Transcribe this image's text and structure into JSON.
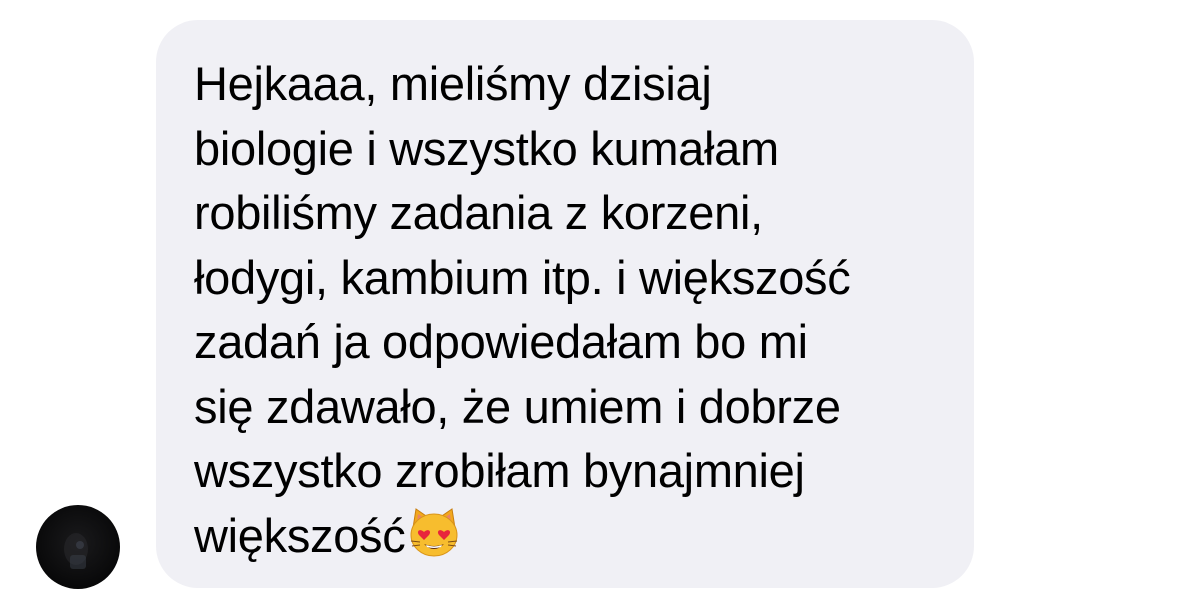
{
  "conversation": {
    "message": {
      "lines": [
        "Hejkaaa, mieliśmy dzisiaj",
        "biologie i wszystko kumałam",
        "robiliśmy zadania z korzeni,",
        "łodygi, kambium itp. i większość",
        "zadań ja odpowiedałam bo mi",
        "się zdawało, że umiem i dobrze",
        "wszystko zrobiłam bynajmniej",
        "większość"
      ],
      "emoji": "heart-eyes-cat-emoji"
    },
    "sender": {
      "avatar": "sender-avatar"
    }
  },
  "colors": {
    "bubble_bg": "#f0f0f5",
    "text": "#000000",
    "page_bg": "#ffffff"
  }
}
